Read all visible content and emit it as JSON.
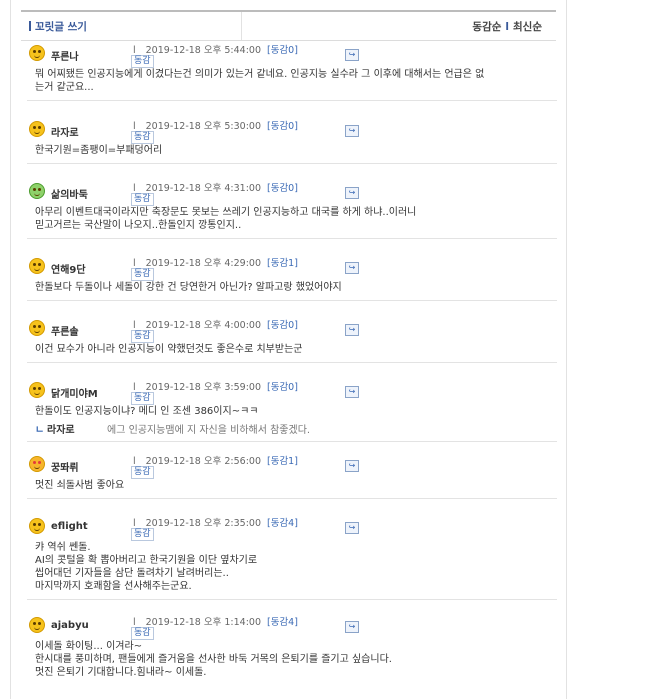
{
  "header": {
    "write_label": "꼬릿글 쓰기",
    "sort_by_agree": "동감순",
    "sort_divider": "l",
    "sort_by_latest": "최신순"
  },
  "comments": [
    {
      "nick": "푸른나",
      "date": "2019-12-18 오후 5:44:00",
      "agree": "[동감0]",
      "agree_btn": "동감",
      "text": "뭐 어찌됐든 인공지능에게 이겼다는건 의미가 있는거 같네요. 인공지능 실수라 그 이후에 대해서는 언급은 없\n는거 같군요..."
    },
    {
      "nick": "라자로",
      "date": "2019-12-18 오후 5:30:00",
      "agree": "[동감0]",
      "agree_btn": "동감",
      "text": "한국기원=좀팽이=부패덩어리"
    },
    {
      "nick": "삶의바둑",
      "date": "2019-12-18 오후 4:31:00",
      "agree": "[동감0]",
      "agree_btn": "동감",
      "text": "아무리 이벤트대국이라지만 축장문도 못보는 쓰레기 인공지능하고 대국를 하게 하냐..이러니\n믿고거르는 국산말이 나오지..한돌인지 깡통인지.."
    },
    {
      "nick": "연해9단",
      "date": "2019-12-18 오후 4:29:00",
      "agree": "[동감1]",
      "agree_btn": "동감",
      "text": "한돌보다 두돌이나 세돌이 강한 건 당연한거 아닌가? 알파고랑 했었어야지"
    },
    {
      "nick": "푸른솔",
      "date": "2019-12-18 오후 4:00:00",
      "agree": "[동감0]",
      "agree_btn": "동감",
      "text": "이건 묘수가 아니라 인공지능이 약했던것도 좋은수로 치부받는군"
    },
    {
      "nick": "닭개미야M",
      "date": "2019-12-18 오후 3:59:00",
      "agree": "[동감0]",
      "agree_btn": "동감",
      "text": "한돌이도 인공지능이냐? 메디 인 조센 386이지~ㅋㅋ",
      "reply": {
        "arrow": "ㄴ",
        "nick": "라자로",
        "text": "에그 인공지능맴에 지 자신을 비하해서 참좋겠다."
      }
    },
    {
      "nick": "꿍똬뤼",
      "date": "2019-12-18 오후 2:56:00",
      "agree": "[동감1]",
      "agree_btn": "동감",
      "text": "멋진 쇠돌사범 좋아요"
    },
    {
      "nick": "eflight",
      "date": "2019-12-18 오후 2:35:00",
      "agree": "[동감4]",
      "agree_btn": "동감",
      "text": "캬 역쉬 쎈돌.\nAI의 콧털을 확 뽑아버리고 한국기원을 이단 옆차기로\n씹어대던 기자들을 삼단 돌려차기 날려버리는..\n마지막까지 호쾌함을 선사해주는군요."
    },
    {
      "nick": "ajabyu",
      "date": "2019-12-18 오후 1:14:00",
      "agree": "[동감4]",
      "agree_btn": "동감",
      "text": "이세돌 화이팅... 이겨라~\n한시대를 풍미하며, 팬들에게 즐거움을 선사한 바둑 거목의 은퇴기를 즐기고 싶습니다.\n멋진 은퇴기 기대합니다.힘내라~ 이세돌."
    }
  ],
  "pipe": "l",
  "reply_icon": "reply-arrow-icon"
}
